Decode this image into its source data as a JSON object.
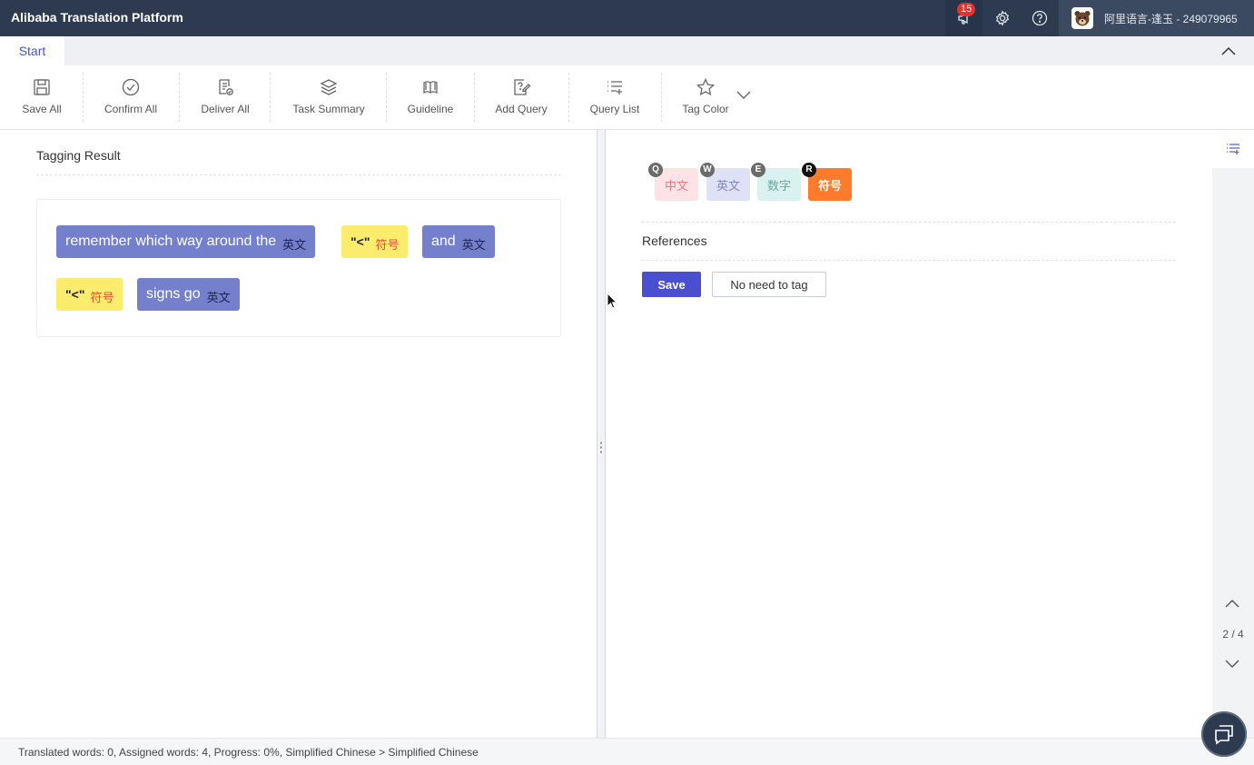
{
  "header": {
    "brand": "Alibaba Translation Platform",
    "notification_count": "15",
    "user": "阿里语言-逢玉 - 249079965"
  },
  "tabs": {
    "start": "Start"
  },
  "toolbar": [
    {
      "label": "Save All",
      "icon": "save-icon"
    },
    {
      "label": "Confirm All",
      "icon": "check-circle-icon"
    },
    {
      "label": "Deliver All",
      "icon": "deliver-doc-icon"
    },
    {
      "label": "Task Summary",
      "icon": "layers-icon"
    },
    {
      "label": "Guideline",
      "icon": "book-icon"
    },
    {
      "label": "Add Query",
      "icon": "edit-query-icon"
    },
    {
      "label": "Query List",
      "icon": "list-add-icon"
    },
    {
      "label": "Tag Color",
      "icon": "star-icon"
    }
  ],
  "tagging": {
    "title": "Tagging Result",
    "chips": [
      {
        "text": "remember which way around the",
        "tag": "英文",
        "kind": "en"
      },
      {
        "text": "\"<\"",
        "tag": "符号",
        "kind": "sym"
      },
      {
        "text": "and",
        "tag": "英文",
        "kind": "en"
      },
      {
        "text": "\"<\"",
        "tag": "符号",
        "kind": "sym"
      },
      {
        "text": "signs go",
        "tag": "英文",
        "kind": "en"
      }
    ]
  },
  "tag_buttons": [
    {
      "hotkey": "Q",
      "label": "中文"
    },
    {
      "hotkey": "W",
      "label": "英文"
    },
    {
      "hotkey": "E",
      "label": "数字"
    },
    {
      "hotkey": "R",
      "label": "符号"
    }
  ],
  "references": {
    "title": "References",
    "save_label": "Save",
    "no_tag_label": "No need to tag"
  },
  "pager": {
    "text": "2 / 4"
  },
  "status": {
    "text": "Translated words: 0, Assigned words: 4, Progress: 0%, Simplified Chinese > Simplified Chinese"
  },
  "colors": {
    "topbar": "#2d3a4f",
    "accent": "#4a55c7",
    "en_chip": "#7580cc",
    "sym_chip": "#fbec6d",
    "symbol_tag_active": "#fd7b2a"
  }
}
